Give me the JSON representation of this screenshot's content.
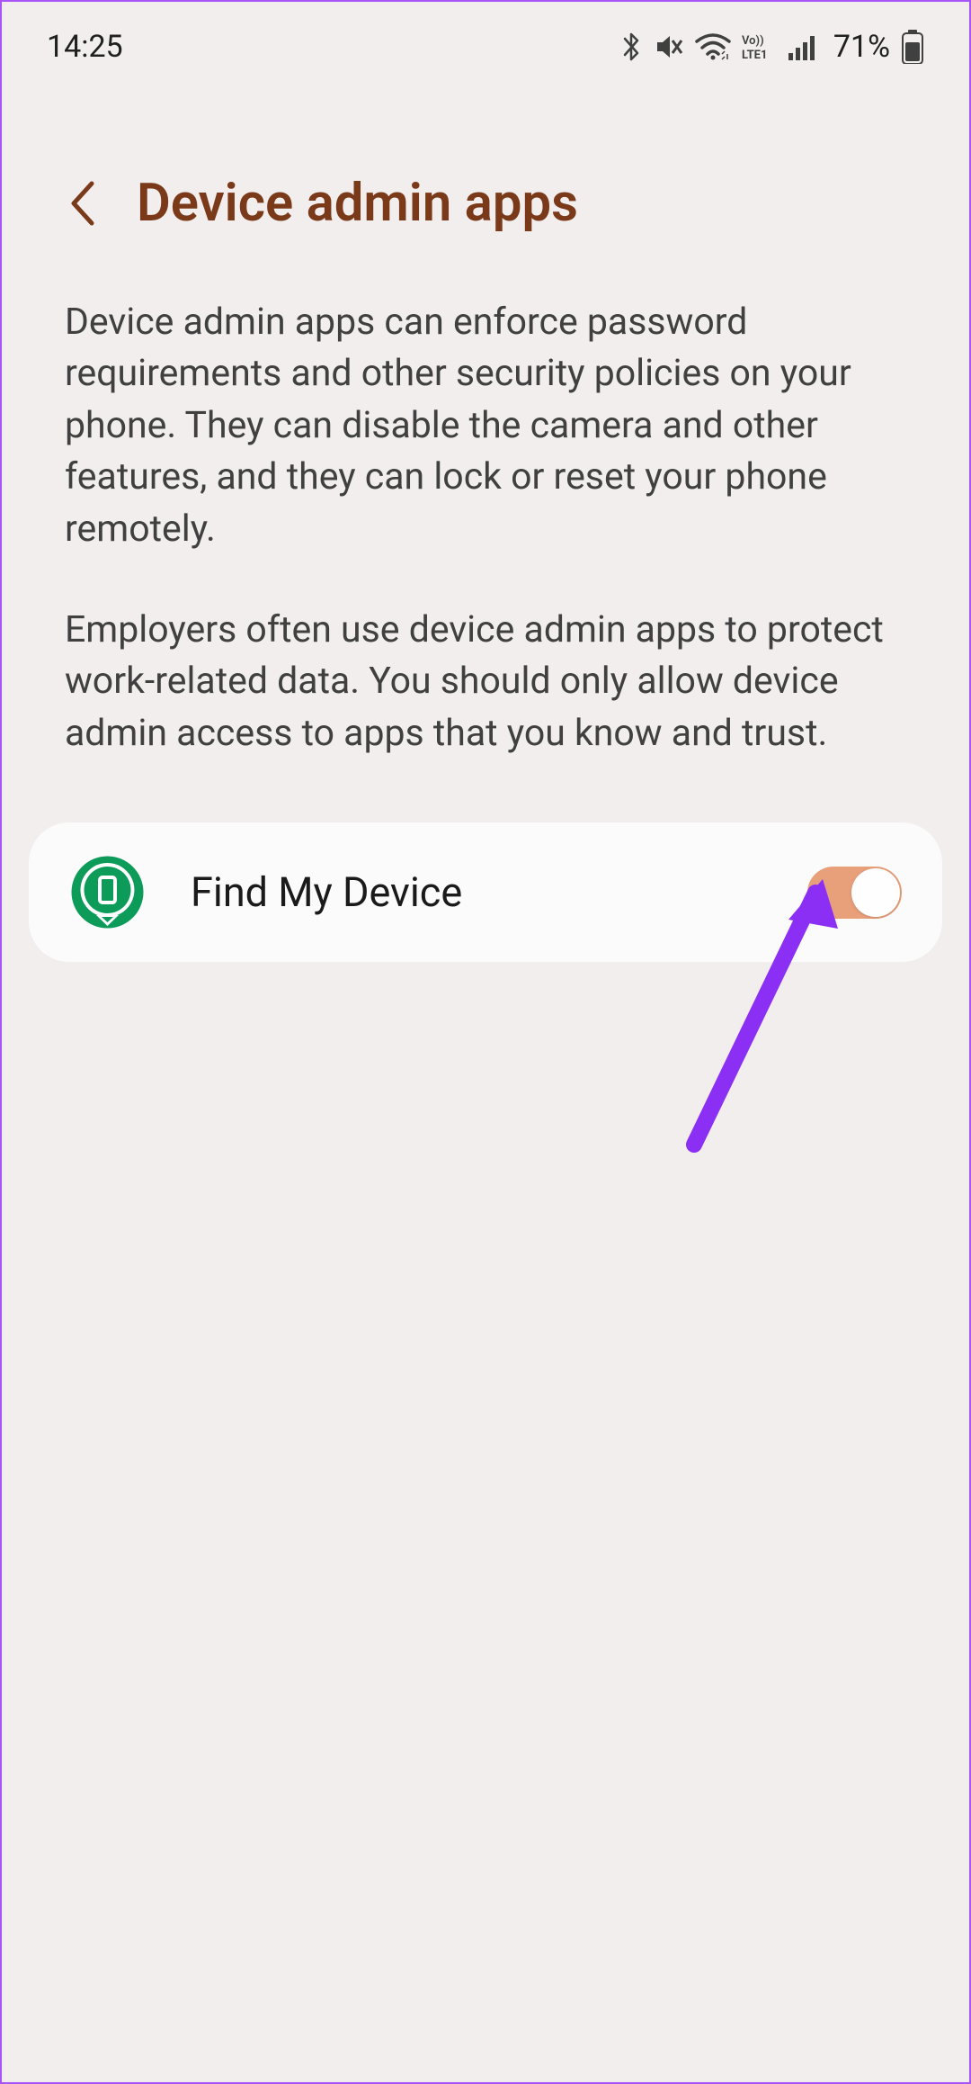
{
  "status": {
    "time": "14:25",
    "battery": "71%"
  },
  "header": {
    "title": "Device admin apps"
  },
  "description": {
    "para1": "Device admin apps can enforce password requirements and other security policies on your phone. They can disable the camera and other features, and they can lock or reset your phone remotely.",
    "para2": "Employers often use device admin apps to protect work-related data. You should only allow device admin access to apps that you know and trust."
  },
  "apps": [
    {
      "label": "Find My Device",
      "enabled": true
    }
  ]
}
